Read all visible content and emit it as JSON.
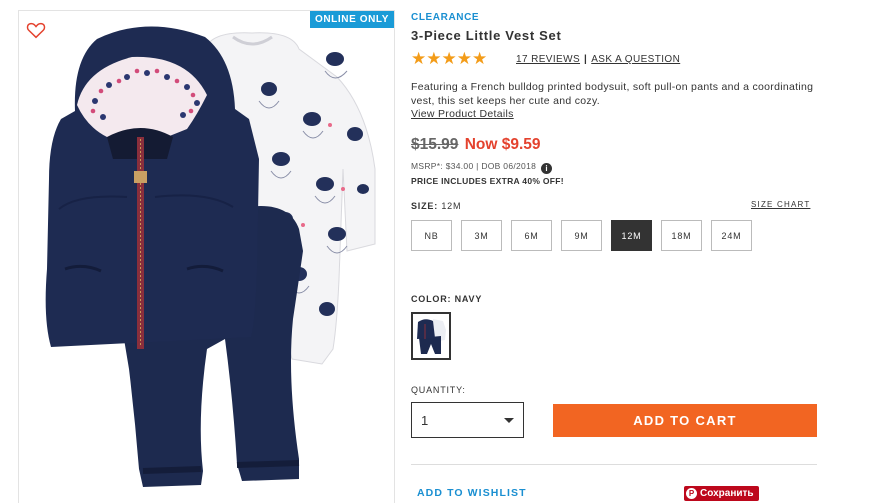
{
  "image_panel": {
    "badge": "ONLINE ONLY",
    "heart_icon": "heart-outline-icon"
  },
  "product": {
    "tag": "CLEARANCE",
    "title": "3-Piece Little Vest Set",
    "stars": "★★★★★",
    "rating": 5,
    "reviews_link": "17 REVIEWS",
    "separator": "|",
    "ask_link": "ASK A QUESTION",
    "description": "Featuring a French bulldog printed bodysuit, soft pull-on pants and a coordinating vest, this set keeps her cute and cozy.",
    "view_details": "View Product Details",
    "old_price": "$15.99",
    "now_price": "Now $9.59",
    "msrp": "MSRP*: $34.00 | DOB 06/2018",
    "info_icon": "i",
    "extra_off": "PRICE INCLUDES EXTRA 40% OFF!"
  },
  "size": {
    "label": "SIZE:",
    "selected": "12M",
    "chart_link": "SIZE CHART",
    "options": [
      "NB",
      "3M",
      "6M",
      "9M",
      "12M",
      "18M",
      "24M"
    ]
  },
  "color": {
    "label": "COLOR:",
    "selected": "NAVY"
  },
  "quantity": {
    "label": "QUANTITY:",
    "value": "1"
  },
  "actions": {
    "add_to_cart": "ADD TO CART",
    "wishlist": "ADD TO WISHLIST",
    "pin_logo": "P",
    "pin_label": "Сохранить"
  },
  "colors": {
    "clearance_blue": "#1a8fd1",
    "star_orange": "#f39c19",
    "sale_red": "#e4422e",
    "cart_orange": "#f26522",
    "pinterest_red": "#bd081c",
    "navy": "#1c2748"
  }
}
